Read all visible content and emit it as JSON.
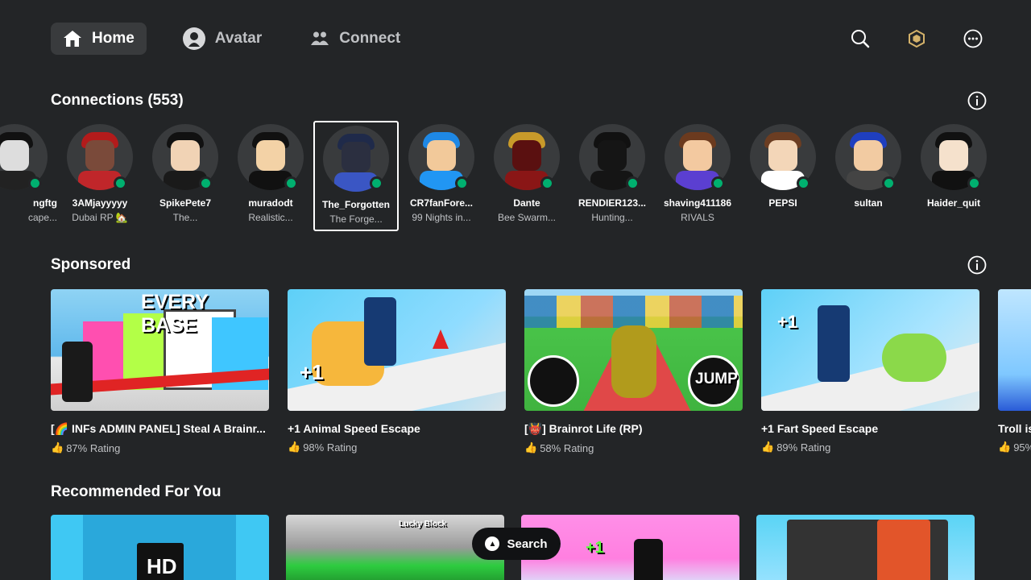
{
  "nav": {
    "tabs": [
      {
        "label": "Home",
        "icon": "home-icon",
        "active": true
      },
      {
        "label": "Avatar",
        "icon": "avatar-icon",
        "active": false
      },
      {
        "label": "Connect",
        "icon": "people-icon",
        "active": false
      }
    ],
    "right_icons": [
      "search-icon",
      "robux-icon",
      "more-icon"
    ]
  },
  "connections": {
    "title": "Connections (553)",
    "friends": [
      {
        "name": "ngftg",
        "sub": "cape..."
      },
      {
        "name": "3AMjayyyyy",
        "sub": "Dubai RP 🏡"
      },
      {
        "name": "SpikePete7",
        "sub": "The..."
      },
      {
        "name": "muradodt",
        "sub": "Realistic..."
      },
      {
        "name": "The_Forgotten",
        "sub": "The Forge..."
      },
      {
        "name": "CR7fanFore...",
        "sub": "99 Nights in..."
      },
      {
        "name": "Dante",
        "sub": "Bee Swarm..."
      },
      {
        "name": "RENDIER123...",
        "sub": "Hunting..."
      },
      {
        "name": "shaving411186",
        "sub": "RIVALS"
      },
      {
        "name": "PEPSI",
        "sub": ""
      },
      {
        "name": "sultan",
        "sub": ""
      },
      {
        "name": "Haider_quit",
        "sub": ""
      }
    ]
  },
  "sponsored": {
    "title": "Sponsored",
    "games": [
      {
        "title": "[🌈 INFs ADMIN PANEL] Steal A Brainr...",
        "rating": "87% Rating",
        "thumb_text": "EVERY BASE"
      },
      {
        "title": "+1 Animal Speed Escape",
        "rating": "98% Rating",
        "thumb_text": "+1"
      },
      {
        "title": "[👹] Brainrot Life (RP)",
        "rating": "58% Rating",
        "thumb_text": "JUMP"
      },
      {
        "title": "+1 Fart Speed Escape",
        "rating": "89% Rating",
        "thumb_text": "+1"
      },
      {
        "title": "Troll is",
        "rating": "95%",
        "thumb_text": ""
      }
    ]
  },
  "recommended": {
    "title": "Recommended For You",
    "thumb_texts": [
      "HD",
      "Lucky Block",
      "+1",
      ""
    ]
  },
  "search_pill": {
    "label": "Search"
  },
  "colors": {
    "background": "#232527",
    "online": "#00b06f",
    "active_tab": "#393b3d"
  }
}
